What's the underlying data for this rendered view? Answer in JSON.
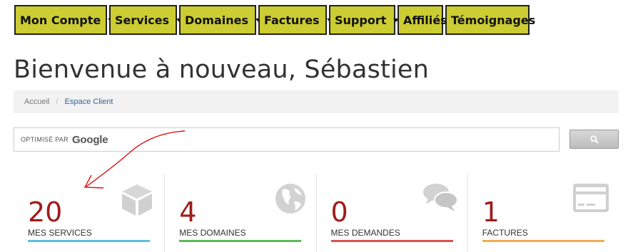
{
  "nav": {
    "items": [
      {
        "label": "Mon Compte",
        "dropdown": true
      },
      {
        "label": "Services",
        "dropdown": true
      },
      {
        "label": "Domaines",
        "dropdown": true
      },
      {
        "label": "Factures",
        "dropdown": true
      },
      {
        "label": "Support",
        "dropdown": true
      },
      {
        "label": "Affiliés",
        "dropdown": false
      },
      {
        "label": "Témoignages",
        "dropdown": false
      }
    ],
    "color": "#cccc33"
  },
  "page": {
    "title": "Bienvenue à nouveau, Sébastien"
  },
  "breadcrumb": {
    "home": "Accueil",
    "separator": "/",
    "current": "Espace Client"
  },
  "search": {
    "powered_by": "OPTIMISÉ PAR",
    "brand": "Google",
    "button_icon": "search-icon"
  },
  "tiles": [
    {
      "count": "20",
      "label": "MES SERVICES",
      "icon": "cube-icon",
      "color": "#5bc0de"
    },
    {
      "count": "4",
      "label": "MES DOMAINES",
      "icon": "globe-icon",
      "color": "#5cb85c"
    },
    {
      "count": "0",
      "label": "MES DEMANDES",
      "icon": "chat-bubbles-icon",
      "color": "#d9534f"
    },
    {
      "count": "1",
      "label": "FACTURES",
      "icon": "credit-card-icon",
      "color": "#f0ad4e"
    }
  ],
  "colors": {
    "count": "#a01c1c",
    "annotation": "#dd1111"
  }
}
